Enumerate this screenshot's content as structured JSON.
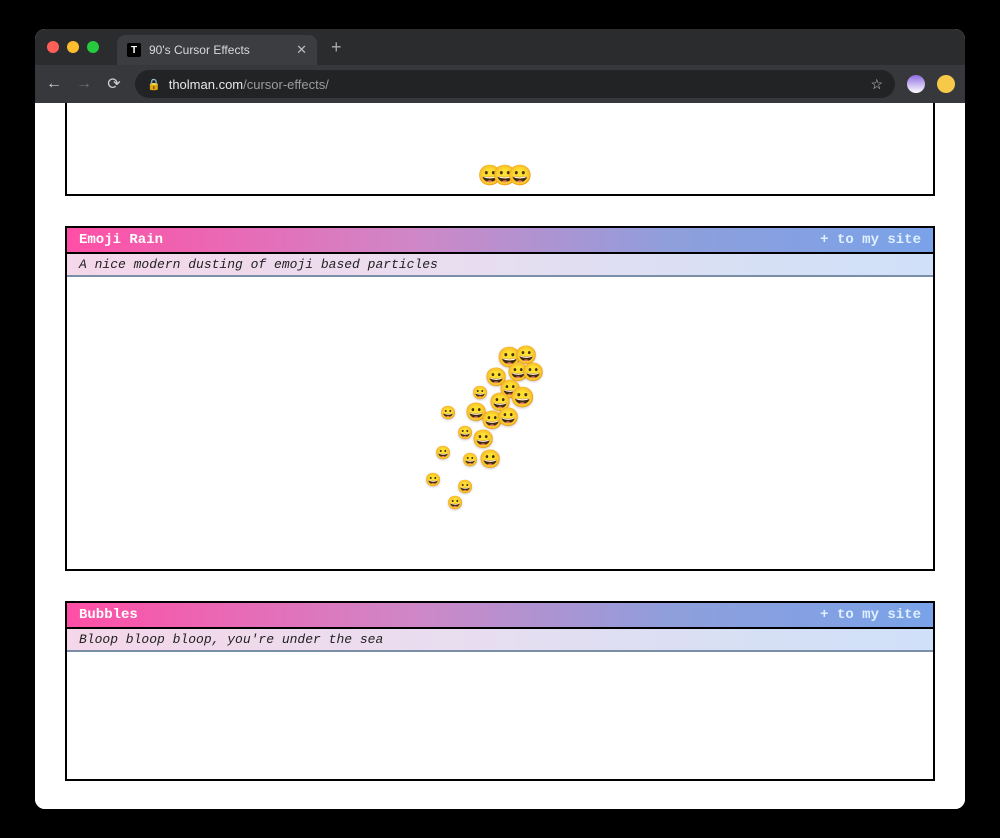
{
  "browser": {
    "tab": {
      "favicon_letter": "T",
      "title": "90's Cursor Effects"
    },
    "url": {
      "domain": "tholman.com",
      "path": "/cursor-effects/"
    }
  },
  "cards": {
    "top_partial": {
      "particle_emoji": "😀"
    },
    "emoji_rain": {
      "title": "Emoji Rain",
      "add_label": "+ to my site",
      "description": "A nice modern dusting of emoji based particles",
      "particle_emoji": "😀"
    },
    "bubbles": {
      "title": "Bubbles",
      "add_label": "+ to my site",
      "description": "Bloop bloop bloop, you're under the sea"
    }
  }
}
